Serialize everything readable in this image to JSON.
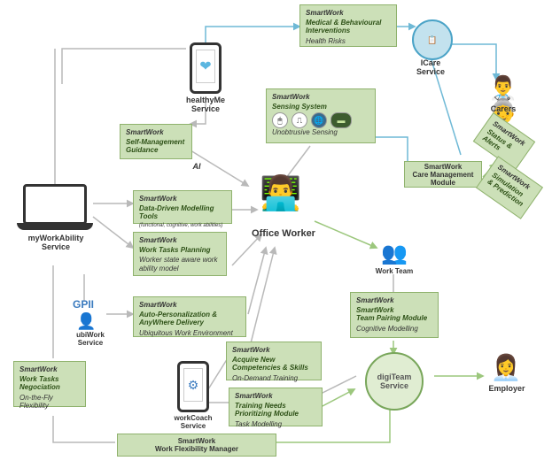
{
  "brand": "SmartWork",
  "services": {
    "healthyMe": "healthyMe\nService",
    "icare": "ICare\nService",
    "myworkability": "myWorkAbility\nService",
    "ubiwork": "ubiWork\nService",
    "workcoach": "workCoach\nService",
    "digiteam": "digiTeam\nService"
  },
  "actors": {
    "office_worker": "Office Worker",
    "carers": "Carers",
    "work_team": "Work Team",
    "employer": "Employer",
    "ai": "AI"
  },
  "modules": {
    "medical": {
      "head": "SmartWork",
      "core": "Medical & Behavioural Interventions",
      "sub": "Health Risks"
    },
    "sensing": {
      "head": "SmartWork",
      "core": "Sensing System",
      "sub": "Unobtrusive Sensing"
    },
    "selfmgmt": {
      "head": "SmartWork",
      "core": "Self-Management Guidance",
      "sub": ""
    },
    "datatools": {
      "head": "SmartWork",
      "core": "Data-Driven Modelling Tools",
      "sub": "(functional, cognitive, work abilities)"
    },
    "tasks": {
      "head": "SmartWork",
      "core": "Work Tasks Planning",
      "sub": "Worker state aware work ability model"
    },
    "autopers": {
      "head": "SmartWork",
      "core": "Auto-Personalization & AnyWhere Delivery",
      "sub": "Ubiquitous Work Environment"
    },
    "competencies": {
      "head": "SmartWork",
      "core": "Acquire New Competencies & Skills",
      "sub": "On-Demand Training"
    },
    "training": {
      "head": "SmartWork",
      "core": "Training Needs Prioritizing Module",
      "sub": "Task Modelling"
    },
    "negociation": {
      "head": "SmartWork",
      "core": "Work Tasks Negociation",
      "sub": "On-the-Fly Flexibility"
    },
    "care": {
      "head": "",
      "core": "SmartWork\nCare Management Module",
      "sub": ""
    },
    "status": {
      "head": "SmartWork",
      "core": "Status & Alerts",
      "sub": ""
    },
    "simpred": {
      "head": "SmartWork",
      "core": "Simulation & Prediction",
      "sub": ""
    },
    "team": {
      "head": "SmartWork",
      "core": "SmartWork\nTeam Pairing Module",
      "sub": "Cognitive Modelling"
    },
    "flex": {
      "head": "",
      "core": "SmartWork\nWork Flexibility Manager",
      "sub": ""
    }
  },
  "gpii": "GPII"
}
